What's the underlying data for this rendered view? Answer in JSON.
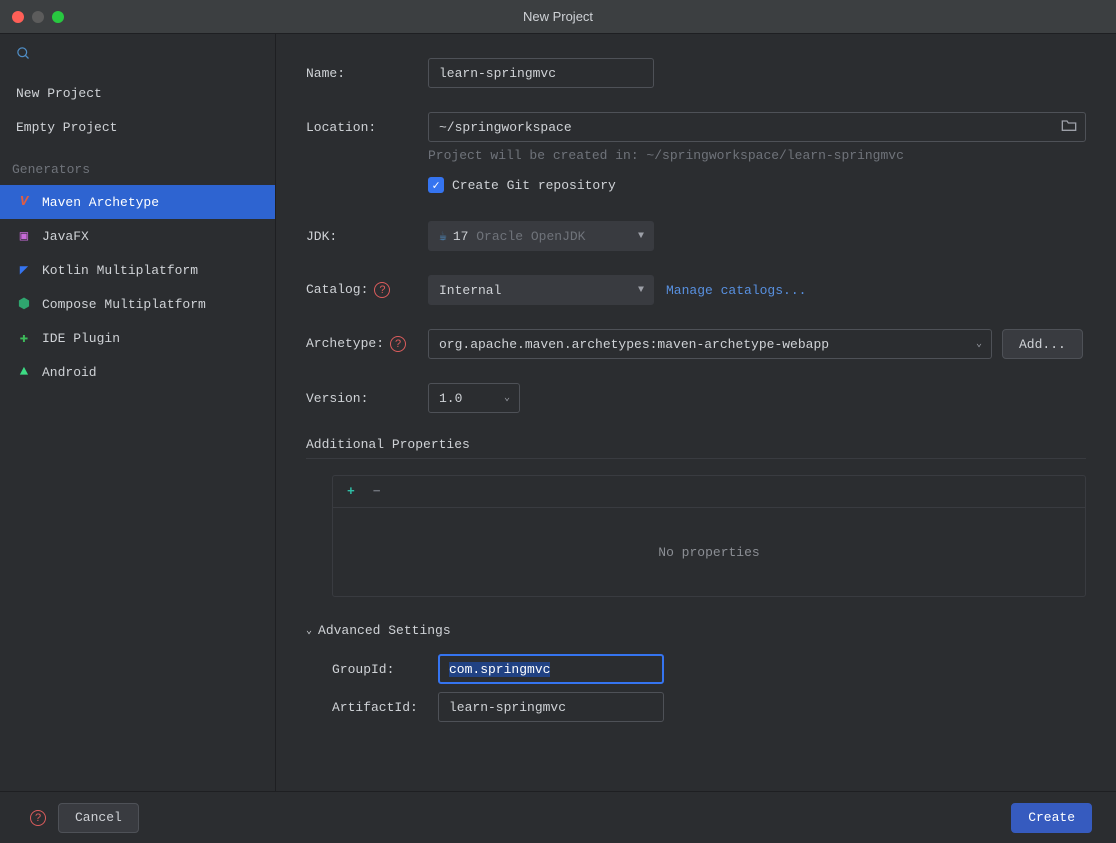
{
  "window": {
    "title": "New Project"
  },
  "sidebar": {
    "projects": [
      {
        "label": "New Project"
      },
      {
        "label": "Empty Project"
      }
    ],
    "generators_header": "Generators",
    "generators": [
      {
        "label": "Maven Archetype",
        "icon": "maven-icon",
        "color": "#e05d44",
        "selected": true
      },
      {
        "label": "JavaFX",
        "icon": "javafx-icon",
        "color": "#c76bd8"
      },
      {
        "label": "Kotlin Multiplatform",
        "icon": "kotlin-icon",
        "color": "#3574f0"
      },
      {
        "label": "Compose Multiplatform",
        "icon": "compose-icon",
        "color": "#2fa66f"
      },
      {
        "label": "IDE Plugin",
        "icon": "plugin-icon",
        "color": "#3dbb5a"
      },
      {
        "label": "Android",
        "icon": "android-icon",
        "color": "#3ddc84"
      }
    ]
  },
  "form": {
    "name_label": "Name:",
    "name_value": "learn-springmvc",
    "location_label": "Location:",
    "location_value": "~/springworkspace",
    "location_hint": "Project will be created in: ~/springworkspace/learn-springmvc",
    "git_label": "Create Git repository",
    "jdk_label": "JDK:",
    "jdk_version": "17",
    "jdk_vendor": "Oracle OpenJDK",
    "catalog_label": "Catalog:",
    "catalog_value": "Internal",
    "manage_catalogs": "Manage catalogs...",
    "archetype_label": "Archetype:",
    "archetype_value": "org.apache.maven.archetypes:maven-archetype-webapp",
    "add_button": "Add...",
    "version_label": "Version:",
    "version_value": "1.0",
    "props_title": "Additional Properties",
    "props_empty": "No properties",
    "adv_title": "Advanced Settings",
    "groupid_label": "GroupId:",
    "groupid_value": "com.springmvc",
    "artifactid_label": "ArtifactId:",
    "artifactid_value": "learn-springmvc"
  },
  "footer": {
    "cancel": "Cancel",
    "create": "Create"
  }
}
